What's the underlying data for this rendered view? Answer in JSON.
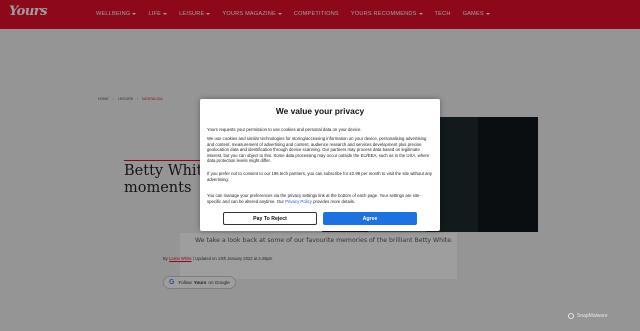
{
  "header": {
    "logo": "Yours",
    "nav": [
      {
        "label": "WELLBEING",
        "caret": true
      },
      {
        "label": "LIFE",
        "caret": true
      },
      {
        "label": "LEISURE",
        "caret": true
      },
      {
        "label": "YOURS MAGAZINE",
        "caret": true
      },
      {
        "label": "COMPETITIONS",
        "caret": false
      },
      {
        "label": "YOURS RECOMMENDS",
        "caret": true
      },
      {
        "label": "TECH",
        "caret": false
      },
      {
        "label": "GAMES",
        "caret": true
      }
    ]
  },
  "article": {
    "breadcrumb": [
      "HOME",
      "LEISURE",
      "NOSTALGIA"
    ],
    "title_line1": "Betty White’",
    "title_line2": "moments",
    "standfirst": "We take a look back at some of our favourite memories of the brilliant Betty White.",
    "byline_by": "By",
    "author": "Lorne White",
    "byline_updated": "| Updated on 13th January 2022 at 4.28pm",
    "follow_prefix": "Follow",
    "follow_brand": "Yours",
    "follow_suffix": "on Google"
  },
  "consent": {
    "title": "We value your privacy",
    "p1": "Yours requests your permission to use cookies and personal data on your device.",
    "p2": "We use cookies and similar technologies for storing/accessing information on your device, personalising advertising and content, measurement of advertising and content, audience research and services development plus precise geolocation data and identification through device scanning. Our partners may process data based on legitimate interest, but you can object to this. Some data processing may occur outside the EU/EEA, such as in the USA, where data protection levels might differ.",
    "p3": "If you prefer not to consent to our 196 tech partners, you can subscribe for £2.99 per month to visit the site without any advertising.",
    "p4_before": "You can manage your preferences via the privacy settings link at the bottom of each page. Your settings are site-specific and can be altered anytime. Our",
    "p4_link": "Privacy Policy",
    "p4_after": "provides more details.",
    "reject_label": "Pay To Reject",
    "agree_label": "Agree"
  },
  "badge": "SnapMalware",
  "colors": {
    "brand_red": "#e4102b",
    "agree_blue": "#1c72e0",
    "link_blue": "#1a56d6"
  }
}
